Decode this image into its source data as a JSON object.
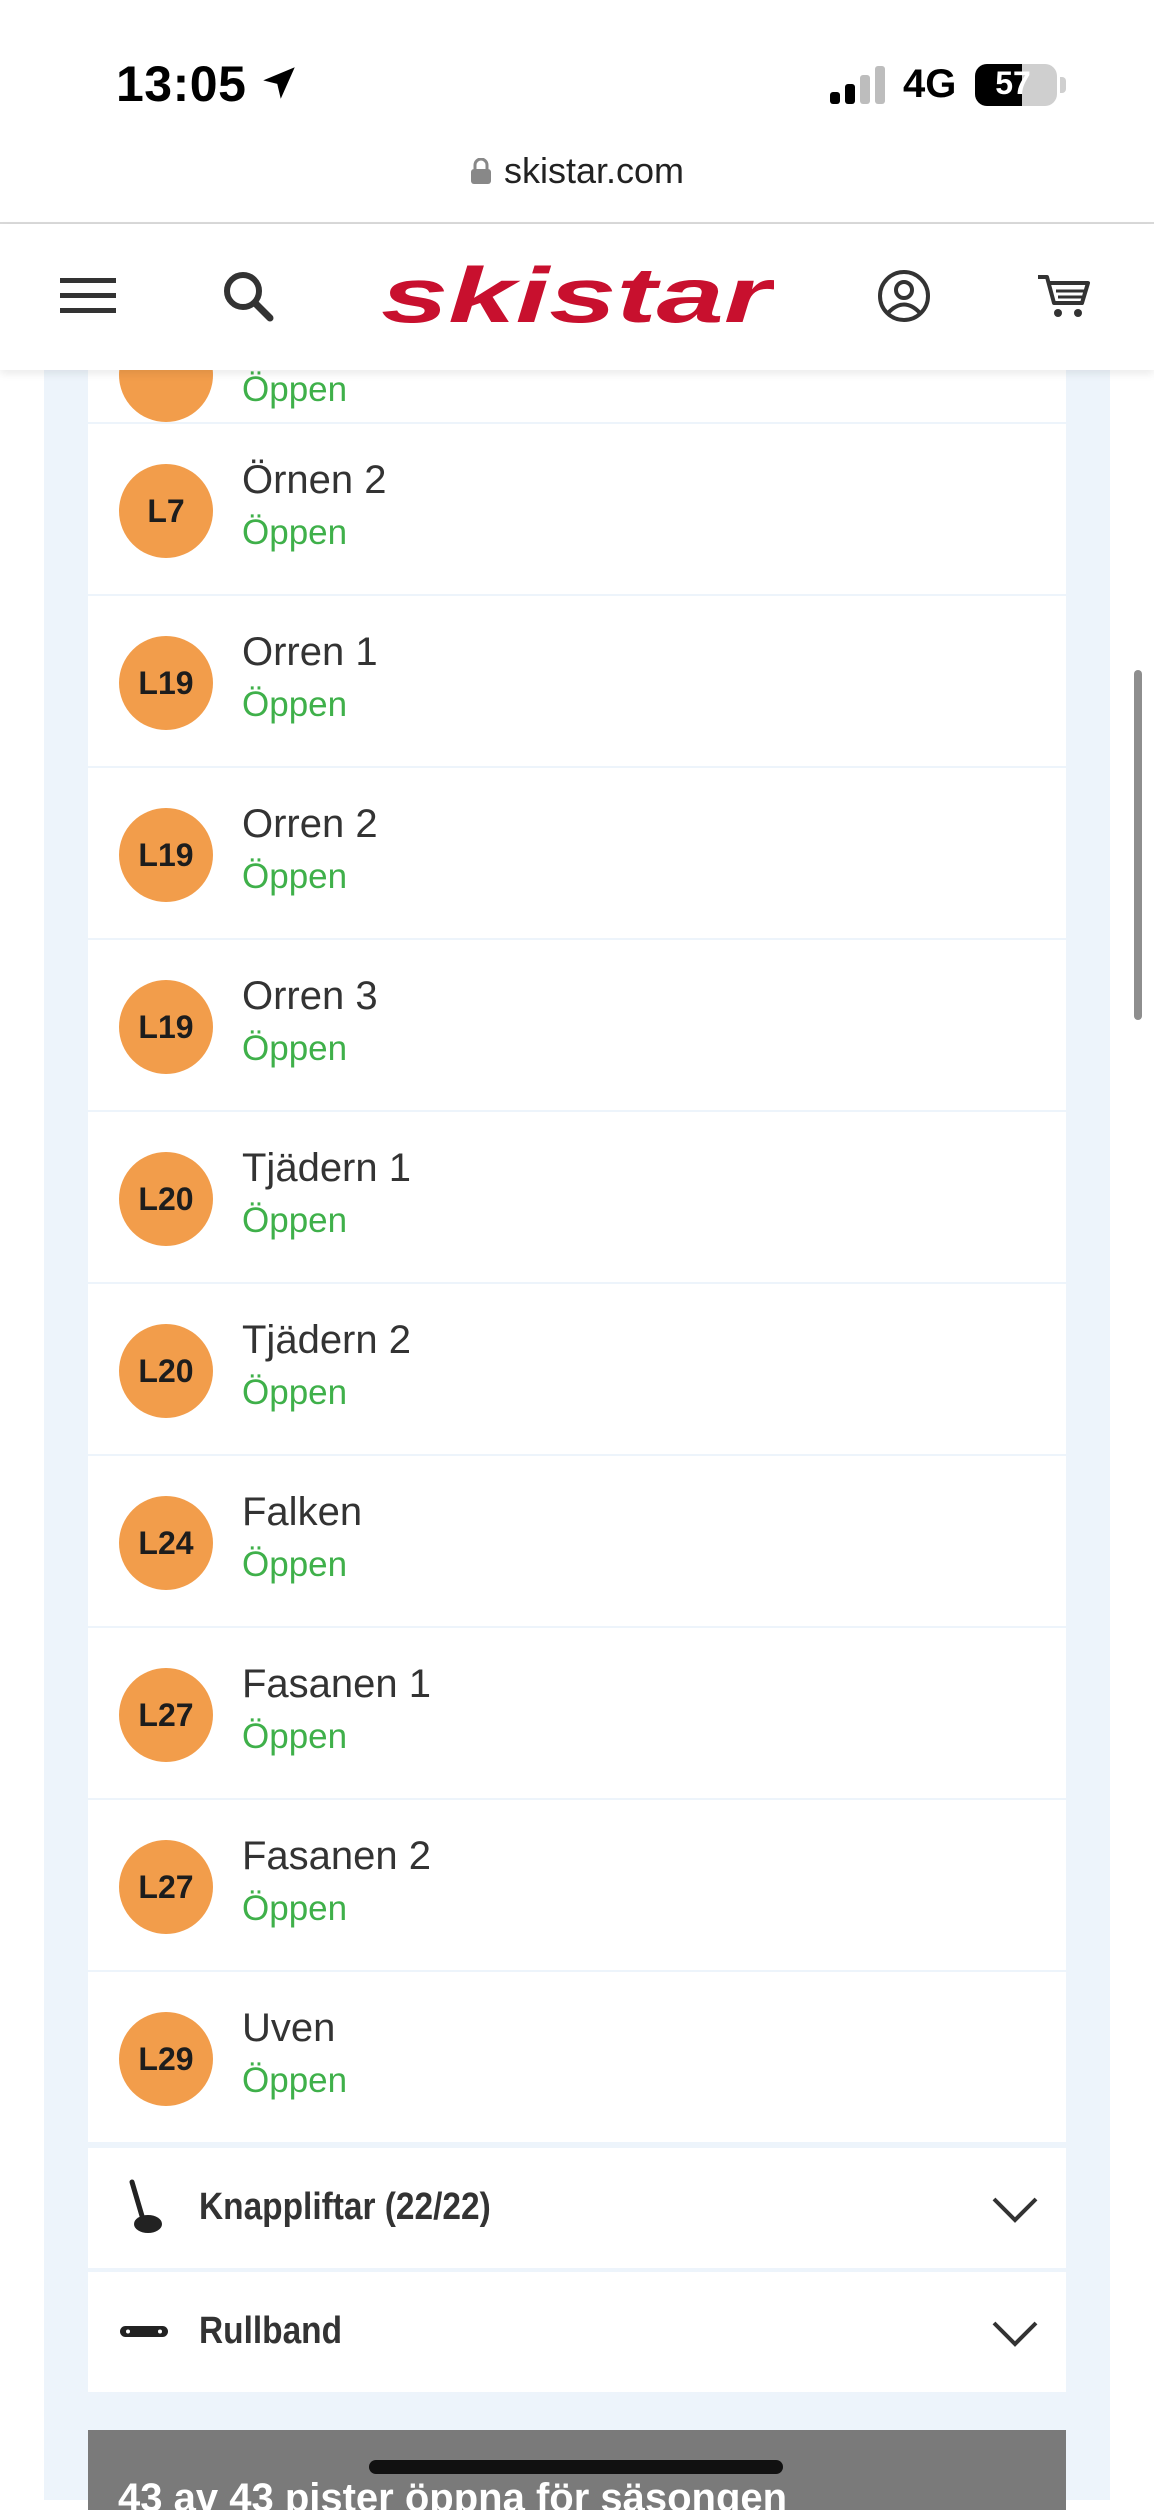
{
  "status_bar": {
    "time": "13:05",
    "network": "4G",
    "battery": "57",
    "battery_level": 0.57,
    "icons": [
      "location-arrow-icon",
      "signal-icon",
      "battery-icon"
    ]
  },
  "browser": {
    "url": "skistar.com",
    "icons": [
      "lock-icon"
    ]
  },
  "header": {
    "logo_text": "skistar",
    "brand_color": "#c8102e",
    "icons": [
      "menu-icon",
      "search-icon",
      "account-icon",
      "cart-icon"
    ]
  },
  "lifts": [
    {
      "code": "",
      "name": "",
      "status": "Öppen"
    },
    {
      "code": "L7",
      "name": "Örnen 2",
      "status": "Öppen"
    },
    {
      "code": "L19",
      "name": "Orren 1",
      "status": "Öppen"
    },
    {
      "code": "L19",
      "name": "Orren 2",
      "status": "Öppen"
    },
    {
      "code": "L19",
      "name": "Orren 3",
      "status": "Öppen"
    },
    {
      "code": "L20",
      "name": "Tjädern 1",
      "status": "Öppen"
    },
    {
      "code": "L20",
      "name": "Tjädern 2",
      "status": "Öppen"
    },
    {
      "code": "L24",
      "name": "Falken",
      "status": "Öppen"
    },
    {
      "code": "L27",
      "name": "Fasanen 1",
      "status": "Öppen"
    },
    {
      "code": "L27",
      "name": "Fasanen 2",
      "status": "Öppen"
    },
    {
      "code": "L29",
      "name": "Uven",
      "status": "Öppen"
    }
  ],
  "sections": [
    {
      "label": "Knappliftar (22/22)",
      "icon": "button-lift-icon"
    },
    {
      "label": "Rullband",
      "icon": "conveyor-belt-icon"
    }
  ],
  "summary": {
    "text": "43 av 43 pister öppna för säsongen"
  },
  "colors": {
    "badge_orange": "#f29d4b",
    "open_green": "#3fb04a",
    "panel_bg": "#edf4fb"
  }
}
